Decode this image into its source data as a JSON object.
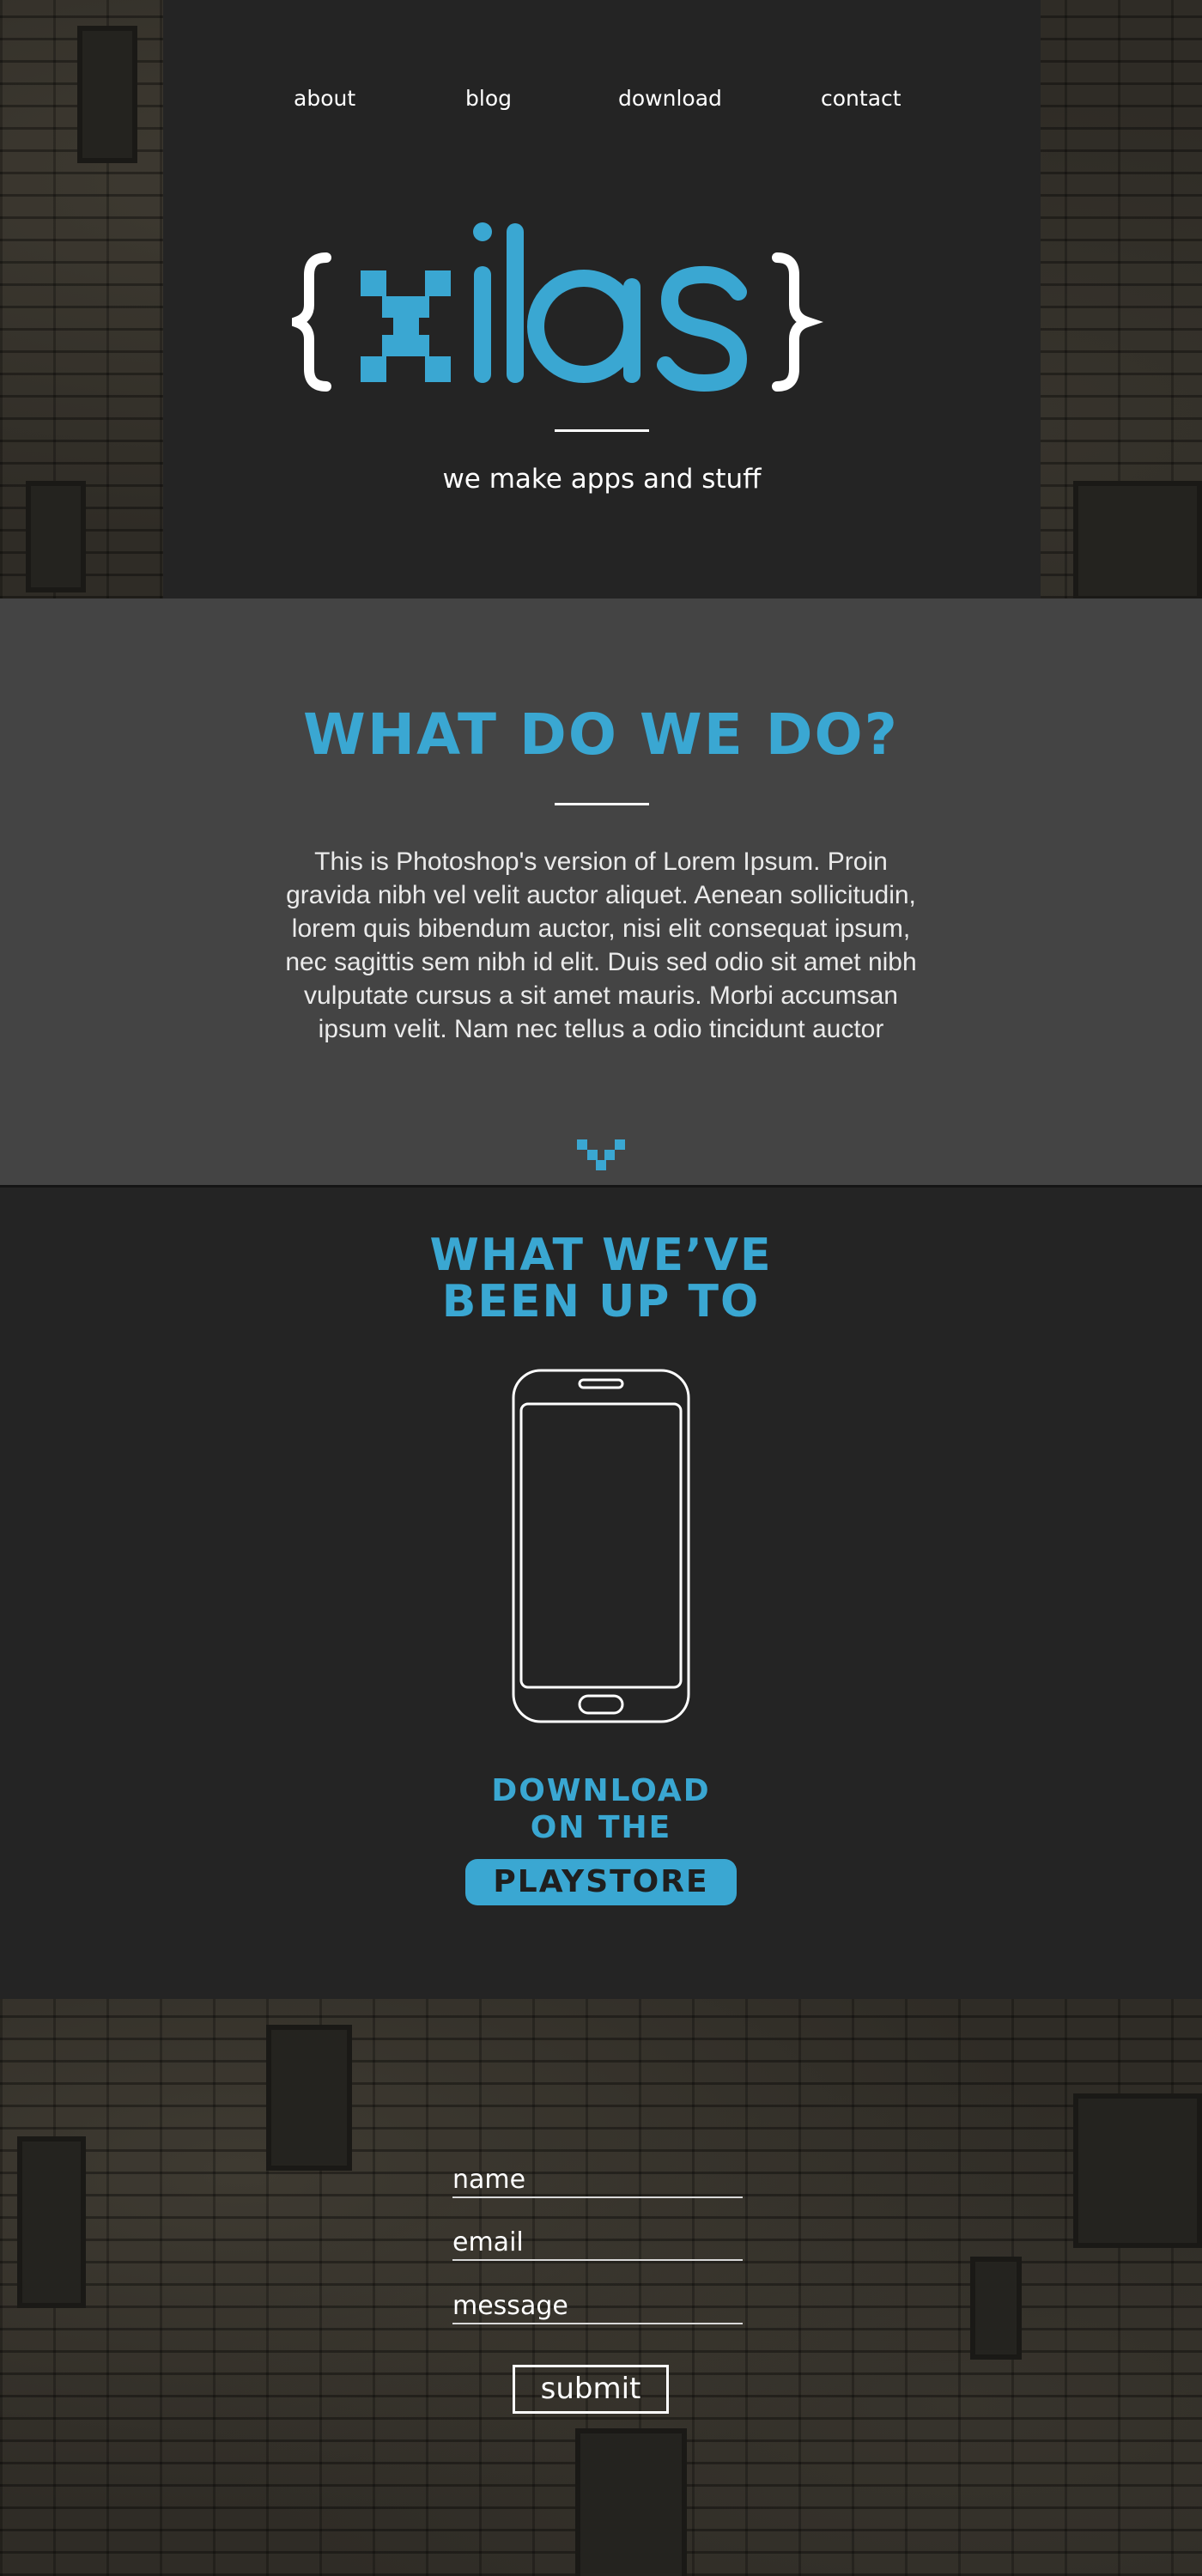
{
  "colors": {
    "accent": "#3aa7d2",
    "header_bg": "#242424",
    "section_bg": "#444444",
    "text_light": "#ffffff"
  },
  "nav": {
    "items": [
      {
        "label": "about"
      },
      {
        "label": "blog"
      },
      {
        "label": "download"
      },
      {
        "label": "contact"
      }
    ]
  },
  "header": {
    "logo_text": "{xilas}",
    "tagline": "we make apps and stuff"
  },
  "what_we_do": {
    "title": "WHAT DO WE DO?",
    "body": "This is Photoshop's version  of Lorem Ipsum. Proin gravida nibh vel velit auctor aliquet. Aenean sollicitudin, lorem quis bibendum auctor, nisi elit consequat ipsum, nec sagittis sem nibh id elit. Duis sed odio sit amet nibh vulputate cursus a sit amet mauris. Morbi accumsan ipsum velit. Nam nec tellus a odio tincidunt auctor",
    "scroll_icon": "chevron-down-icon"
  },
  "projects": {
    "title_line1": "WHAT WE’VE",
    "title_line2": "BEEN UP TO",
    "device_icon": "phone-icon",
    "download_line1": "DOWNLOAD",
    "download_line2": "ON THE",
    "playstore_label": "PLAYSTORE"
  },
  "contact_form": {
    "name_placeholder": "name",
    "email_placeholder": "email",
    "message_placeholder": "message",
    "submit_label": "submit"
  }
}
